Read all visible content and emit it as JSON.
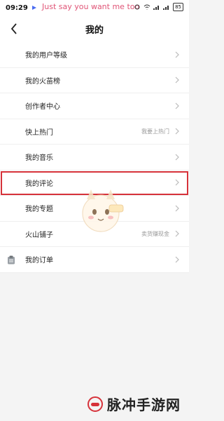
{
  "status_bar": {
    "time": "09:29",
    "watermark_text": "Just say you want me too",
    "battery": "85"
  },
  "header": {
    "title": "我的"
  },
  "menu": {
    "items": [
      {
        "label": "我的用户等级",
        "right": ""
      },
      {
        "label": "我的火苗榜",
        "right": ""
      },
      {
        "label": "创作者中心",
        "right": ""
      },
      {
        "label": "快上热门",
        "right": "我要上热门"
      },
      {
        "label": "我的音乐",
        "right": ""
      },
      {
        "label": "我的评论",
        "right": ""
      },
      {
        "label": "我的专题",
        "right": ""
      },
      {
        "label": "火山铺子",
        "right": "卖货赚现金"
      },
      {
        "label": "我的订单",
        "right": ""
      }
    ]
  },
  "footer_watermark": "脉冲手游网",
  "colors": {
    "highlight_border": "#d6323a",
    "watermark_pink": "#e05577"
  }
}
